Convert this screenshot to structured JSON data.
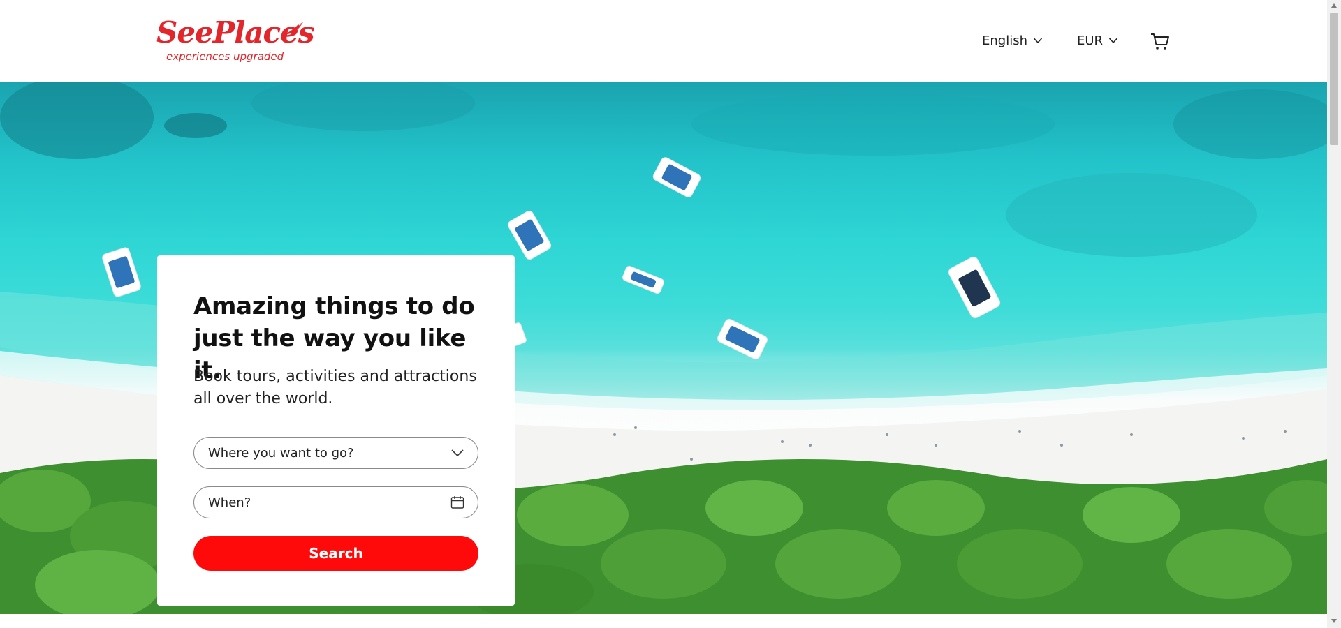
{
  "header": {
    "logo_text": "SeePlaces",
    "logo_tagline": "experiences upgraded",
    "language": "English",
    "currency": "EUR"
  },
  "hero": {
    "title": "Amazing things to do just the way you like it.",
    "subtitle": "Book tours, activities and attractions all over the world.",
    "destination_placeholder": "Where you want to go?",
    "date_placeholder": "When?",
    "search_label": "Search"
  },
  "icons": {
    "language_dropdown": "chevron-down-icon",
    "currency_dropdown": "chevron-down-icon",
    "cart": "shopping-cart-icon",
    "destination_dropdown": "chevron-down-icon",
    "date": "calendar-icon"
  },
  "colors": {
    "brand": "#e3262b",
    "search_button": "#ff0a0a",
    "sea": "#2ed6d4"
  }
}
